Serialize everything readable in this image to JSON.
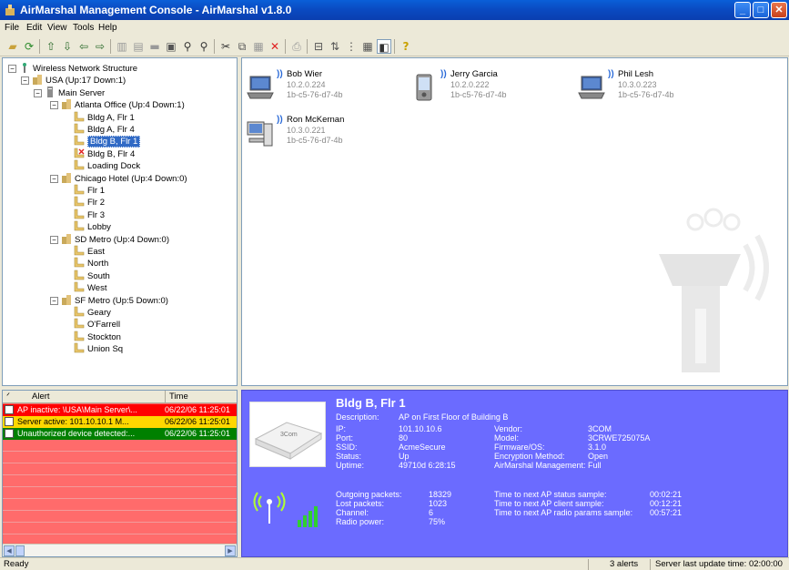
{
  "window": {
    "title": "AirMarshal Management Console - AirMarshal v1.8.0"
  },
  "menu": [
    "File",
    "Edit",
    "View",
    "Tools",
    "Help"
  ],
  "toolbar_icons": [
    "open-folder-icon",
    "refresh-icon",
    "up-arrow-icon",
    "down-arrow-icon",
    "left-arrow-icon",
    "right-arrow-icon",
    "building-icon",
    "floor-icon",
    "server-icon",
    "properties-icon",
    "binoculars-icon",
    "binoculars-next-icon",
    "cut-icon",
    "copy-icon",
    "paste-icon",
    "delete-icon",
    "print-icon",
    "layout-icon",
    "sort-icon",
    "tree-icon",
    "grid-view-icon",
    "toggle-icon",
    "help-icon"
  ],
  "tree": [
    {
      "label": "Wireless Network Structure",
      "level": 0,
      "box": "−",
      "icon": "network-icon"
    },
    {
      "label": "USA (Up:17 Down:1)",
      "level": 1,
      "box": "−",
      "icon": "building-icon"
    },
    {
      "label": "Main Server",
      "level": 2,
      "box": "−",
      "icon": "server-icon"
    },
    {
      "label": "Atlanta Office (Up:4 Down:1)",
      "level": 3,
      "box": "−",
      "icon": "building-icon"
    },
    {
      "label": "Bldg A, Flr 1",
      "level": 4,
      "icon": "floor-icon"
    },
    {
      "label": "Bldg A, Flr 4",
      "level": 4,
      "icon": "floor-icon"
    },
    {
      "label": "Bldg B, Flr 1",
      "level": 4,
      "icon": "floor-icon",
      "selected": true
    },
    {
      "label": "Bldg B, Flr 4",
      "level": 4,
      "icon": "floor-down-icon"
    },
    {
      "label": "Loading Dock",
      "level": 4,
      "icon": "floor-icon"
    },
    {
      "label": "Chicago Hotel (Up:4 Down:0)",
      "level": 3,
      "box": "−",
      "icon": "building-icon"
    },
    {
      "label": "Flr 1",
      "level": 4,
      "icon": "floor-icon"
    },
    {
      "label": "Flr 2",
      "level": 4,
      "icon": "floor-icon"
    },
    {
      "label": "Flr 3",
      "level": 4,
      "icon": "floor-icon"
    },
    {
      "label": "Lobby",
      "level": 4,
      "icon": "floor-icon"
    },
    {
      "label": "SD Metro (Up:4 Down:0)",
      "level": 3,
      "box": "−",
      "icon": "building-icon"
    },
    {
      "label": "East",
      "level": 4,
      "icon": "floor-icon"
    },
    {
      "label": "North",
      "level": 4,
      "icon": "floor-icon"
    },
    {
      "label": "South",
      "level": 4,
      "icon": "floor-icon"
    },
    {
      "label": "West",
      "level": 4,
      "icon": "floor-icon"
    },
    {
      "label": "SF Metro (Up:5 Down:0)",
      "level": 3,
      "box": "−",
      "icon": "building-icon"
    },
    {
      "label": "Geary",
      "level": 4,
      "icon": "floor-icon"
    },
    {
      "label": "O'Farrell",
      "level": 4,
      "icon": "floor-icon"
    },
    {
      "label": "Stockton",
      "level": 4,
      "icon": "floor-icon"
    },
    {
      "label": "Union Sq",
      "level": 4,
      "icon": "floor-icon"
    }
  ],
  "devices": [
    {
      "name": "Bob Wier",
      "ip": "10.2.0.224",
      "mac": "1b-c5-76-d7-4b",
      "type": "laptop-icon"
    },
    {
      "name": "Jerry Garcia",
      "ip": "10.2.0.222",
      "mac": "1b-c5-76-d7-4b",
      "type": "pda-icon"
    },
    {
      "name": "Phil Lesh",
      "ip": "10.3.0.223",
      "mac": "1b-c5-76-d7-4b",
      "type": "laptop-icon"
    },
    {
      "name": "Ron McKernan",
      "ip": "10.3.0.221",
      "mac": "1b-c5-76-d7-4b",
      "type": "desktop-icon"
    }
  ],
  "alerts": {
    "col_alert": "Alert",
    "col_time": "Time",
    "rows": [
      {
        "text": "AP inactive: \\USA\\Main Server\\...",
        "time": "06/22/06 11:25:01",
        "color": "#ff0000",
        "fg": "#ffffff"
      },
      {
        "text": "Server active: 101.10.10.1 M...",
        "time": "06/22/06 11:25:01",
        "color": "#ffd700",
        "fg": "#000000"
      },
      {
        "text": "Unauthorized device detected:...",
        "time": "06/22/06 11:25:01",
        "color": "#008000",
        "fg": "#ffffff"
      }
    ]
  },
  "details": {
    "title": "Bldg B, Flr 1",
    "description_label": "Description:",
    "description": "AP on First Floor of Building B",
    "left": [
      {
        "label": "IP:",
        "value": "101.10.10.6"
      },
      {
        "label": "Port:",
        "value": "80"
      },
      {
        "label": "SSID:",
        "value": "AcmeSecure"
      },
      {
        "label": "Status:",
        "value": "Up"
      },
      {
        "label": "Uptime:",
        "value": "49710d 6:28:15"
      }
    ],
    "right": [
      {
        "label": "Vendor:",
        "value": "3COM"
      },
      {
        "label": "Model:",
        "value": "3CRWE725075A"
      },
      {
        "label": "Firmware/OS:",
        "value": "3.1.0"
      },
      {
        "label": "Encryption Method:",
        "value": "Open"
      },
      {
        "label": "AirMarshal Management:",
        "value": "Full"
      }
    ],
    "stats_left": [
      {
        "label": "Outgoing packets:",
        "value": "18329"
      },
      {
        "label": "Lost packets:",
        "value": "1023"
      },
      {
        "label": "Channel:",
        "value": "6"
      },
      {
        "label": "Radio power:",
        "value": "75%"
      }
    ],
    "stats_right": [
      {
        "label": "Time to next AP status sample:",
        "value": "00:02:21"
      },
      {
        "label": "Time to next AP client sample:",
        "value": "00:12:21"
      },
      {
        "label": "Time to next AP radio params sample:",
        "value": "00:57:21"
      }
    ],
    "ap_brand": "3Com"
  },
  "status": {
    "left": "Ready",
    "alerts": "3 alerts",
    "server": "Server last update time: 02:00:00"
  }
}
